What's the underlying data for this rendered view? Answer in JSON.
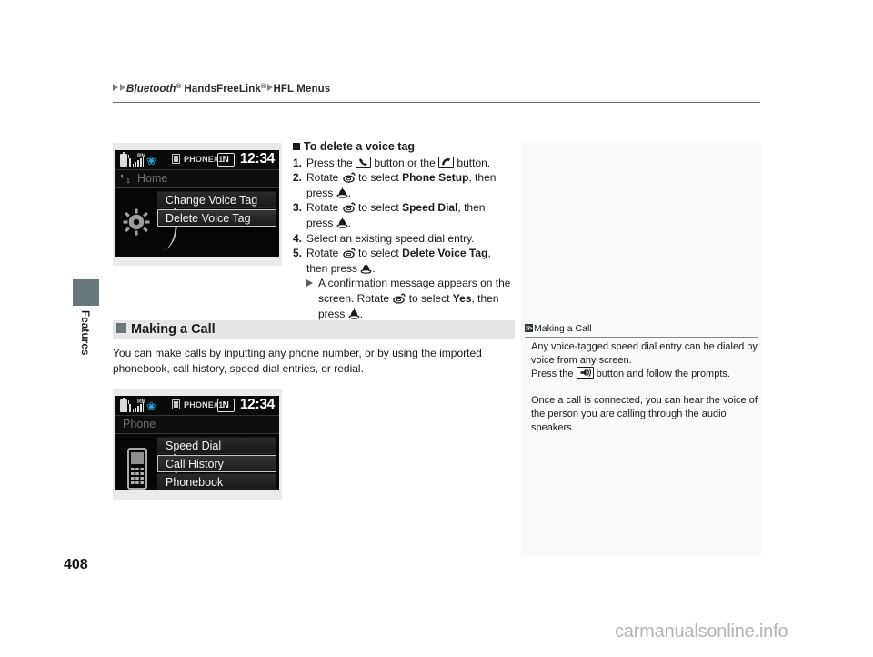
{
  "breadcrumb": {
    "part1": "Bluetooth",
    "sup1": "®",
    "part2": " HandsFreeLink",
    "sup2": "®",
    "part3": "HFL Menus"
  },
  "side_tab": {
    "label": "Features"
  },
  "page_number": "408",
  "watermark": "carmanualsonline.info",
  "instructions": {
    "title": "To delete a voice tag",
    "steps": [
      {
        "num": "1.",
        "pre": "Press the ",
        "mid": " button or the ",
        "post": " button."
      },
      {
        "num": "2.",
        "pre": "Rotate ",
        "mid": " to select ",
        "bold": "Phone Setup",
        "post": ", then press "
      },
      {
        "num": "3.",
        "pre": "Rotate ",
        "mid": " to select ",
        "bold": "Speed Dial",
        "post": ", then press "
      },
      {
        "num": "4.",
        "text": "Select an existing speed dial entry."
      },
      {
        "num": "5.",
        "pre": "Rotate ",
        "mid": " to select ",
        "bold": "Delete Voice Tag",
        "post": ", then press "
      }
    ],
    "substep": {
      "pre": "A confirmation message appears on the screen. Rotate ",
      "mid": " to select ",
      "bold": "Yes",
      "post": ", then press "
    },
    "period": "."
  },
  "section": {
    "heading": "Making a Call",
    "body": "You can make calls by inputting any phone number, or by using the imported phonebook, call history, speed dial entries, or redial."
  },
  "sidebar_note": {
    "header": "Making a Call",
    "icon": "≫",
    "para1_a": "Any voice-tagged speed dial entry can be dialed by voice from any screen.",
    "para1_b_pre": "Press the ",
    "para1_b_post": " button and follow the prompts.",
    "para2": "Once a call is connected, you can hear the voice of the person you are calling through the audio speakers."
  },
  "devshot1": {
    "status": {
      "phone_label": "PHONE#1",
      "gear_badge": "N",
      "clock": "12:34",
      "rm": "RM"
    },
    "title": "Home",
    "items": [
      {
        "label": "Change Voice Tag",
        "selected": false
      },
      {
        "label": "Delete Voice Tag",
        "selected": true
      }
    ]
  },
  "devshot2": {
    "status": {
      "phone_label": "PHONE#1",
      "gear_badge": "N",
      "clock": "12:34",
      "rm": "RM"
    },
    "title": "Phone",
    "items": [
      {
        "label": "Speed Dial",
        "selected": false
      },
      {
        "label": "Call History",
        "selected": true
      },
      {
        "label": "Phonebook",
        "selected": false
      }
    ]
  },
  "colors": {
    "tab_accent": "#68787a",
    "sidebar_bg": "#f8f9f9",
    "heading_band": "#e6e6e6",
    "bluetooth_blue": "#29a8e0"
  }
}
